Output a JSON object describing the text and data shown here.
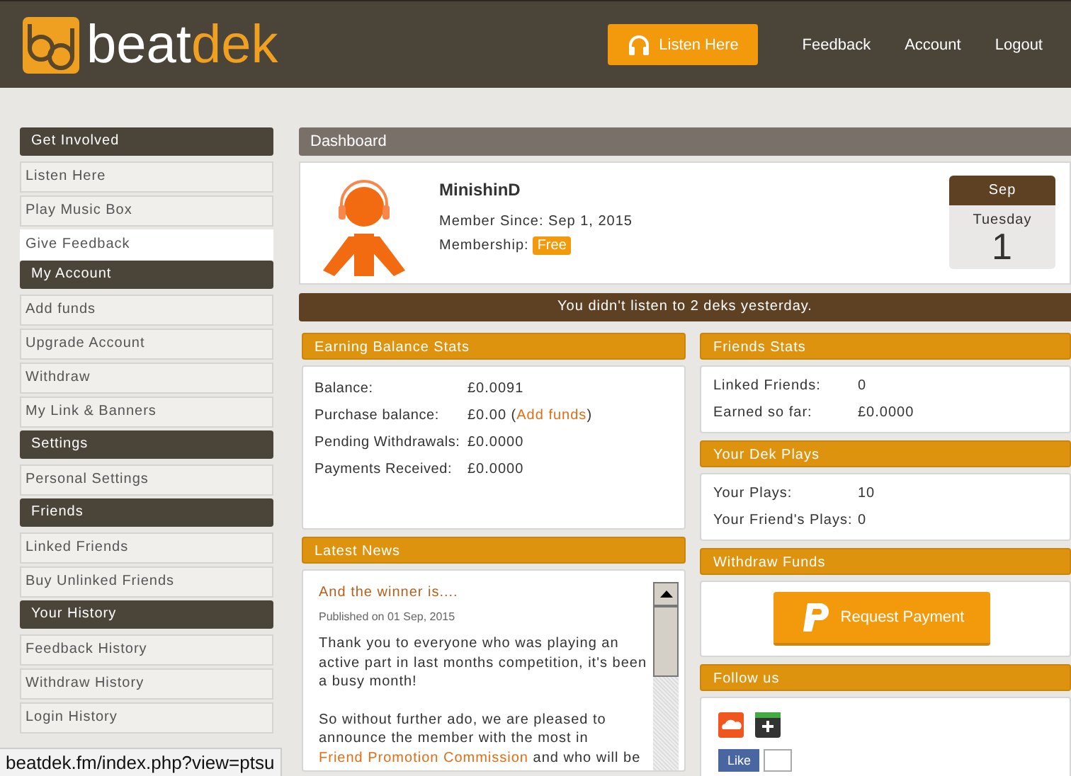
{
  "header": {
    "logo": {
      "part1": "beat",
      "part2": "dek"
    },
    "nav": [
      {
        "label": "Listen Here",
        "kind": "button"
      },
      {
        "label": "Feedback",
        "kind": "link"
      },
      {
        "label": "Account",
        "kind": "link"
      },
      {
        "label": "Logout",
        "kind": "link"
      }
    ]
  },
  "sidebar": {
    "sections": [
      {
        "title": "Get Involved",
        "items": [
          {
            "label": "Listen Here",
            "selected": false
          },
          {
            "label": "Play Music Box",
            "selected": false
          },
          {
            "label": "Give Feedback",
            "selected": true
          }
        ]
      },
      {
        "title": "My Account",
        "items": [
          {
            "label": "Add funds",
            "selected": false
          },
          {
            "label": "Upgrade Account",
            "selected": false
          },
          {
            "label": "Withdraw",
            "selected": false
          },
          {
            "label": "My Link & Banners",
            "selected": false
          }
        ]
      },
      {
        "title": "Settings",
        "items": [
          {
            "label": "Personal Settings",
            "selected": false
          }
        ]
      },
      {
        "title": "Friends",
        "items": [
          {
            "label": "Linked Friends",
            "selected": false
          },
          {
            "label": "Buy Unlinked Friends",
            "selected": false
          }
        ]
      },
      {
        "title": "Your History",
        "items": [
          {
            "label": "Feedback History",
            "selected": false
          },
          {
            "label": "Withdraw History",
            "selected": false
          },
          {
            "label": "Login History",
            "selected": false
          }
        ]
      }
    ]
  },
  "dashboard": {
    "title": "Dashboard",
    "profile": {
      "username": "MinishinD",
      "member_since": "Member Since: Sep 1, 2015",
      "membership_label": "Membership:",
      "membership_badge": "Free"
    },
    "date": {
      "month": "Sep",
      "weekday": "Tuesday",
      "day": "1"
    },
    "notice": "You didn't listen to 2 deks yesterday.",
    "earning_stats": {
      "title": "Earning Balance Stats",
      "rows": [
        {
          "label": "Balance:",
          "value": "£0.0091"
        },
        {
          "label": "Purchase balance:",
          "value": "£0.00 (",
          "link": "Add funds",
          "value_after": ")"
        },
        {
          "label": "Pending Withdrawals:",
          "value": "£0.0000"
        },
        {
          "label": "Payments Received:",
          "value": "£0.0000"
        }
      ]
    },
    "latest_news": {
      "title": "Latest News",
      "headline": "And the winner is....",
      "published": "Published on 01 Sep, 2015",
      "paragraphs": [
        [
          {
            "kind": "text",
            "text": "Thank you to everyone who was playing an active part in last months competition, it's been a busy month!"
          }
        ],
        [
          {
            "kind": "text",
            "text": "So without further ado, we are pleased to announce the member with the most in "
          },
          {
            "kind": "link",
            "text": "Friend Promotion Commission"
          },
          {
            "kind": "text",
            "text": " and who will be"
          }
        ]
      ]
    },
    "friends_stats": {
      "title": "Friends Stats",
      "rows": [
        {
          "label": "Linked Friends:",
          "value": "0"
        },
        {
          "label": "Earned so far:",
          "value": "£0.0000"
        }
      ]
    },
    "dek_plays": {
      "title": "Your Dek Plays",
      "rows": [
        {
          "label": "Your Plays:",
          "value": "10"
        },
        {
          "label": "Your Friend's Plays:",
          "value": "0"
        }
      ]
    },
    "withdraw": {
      "title": "Withdraw Funds",
      "button": "Request Payment"
    },
    "follow": {
      "title": "Follow us",
      "like": "Like"
    }
  },
  "status_bar": {
    "url": "beatdek.fm/index.php?view=ptsu"
  }
}
